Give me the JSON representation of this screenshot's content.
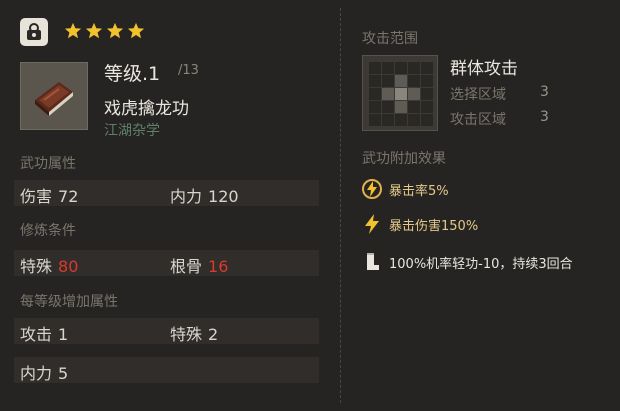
{
  "header": {
    "stars_count": 4
  },
  "item": {
    "level_label": "等级.1",
    "level_max": "/13",
    "name": "戏虎擒龙功",
    "category": "江湖杂学"
  },
  "sections": {
    "attributes": "武功属性",
    "requirements": "修炼条件",
    "per_level": "每等级增加属性"
  },
  "attributes": [
    {
      "label": "伤害",
      "value": "72"
    },
    {
      "label": "内力",
      "value": "120"
    }
  ],
  "requirements": [
    {
      "label": "特殊",
      "value": "80"
    },
    {
      "label": "根骨",
      "value": "16"
    }
  ],
  "per_level": [
    {
      "label": "攻击",
      "value": "1"
    },
    {
      "label": "特殊",
      "value": "2"
    },
    {
      "label": "内力",
      "value": "5"
    }
  ],
  "attack_range": {
    "label": "攻击范围",
    "name": "群体攻击",
    "select_label": "选择区域",
    "select_value": "3",
    "attack_label": "攻击区域",
    "attack_value": "3"
  },
  "effects": {
    "label": "武功附加效果",
    "items": [
      {
        "text": "暴击率5%",
        "icon": "lightning-circle-icon"
      },
      {
        "text": "暴击伤害150%",
        "icon": "lightning-icon"
      },
      {
        "text": "100%机率轻功-10，持续3回合",
        "icon": "boot-icon"
      }
    ]
  },
  "colors": {
    "star": "#f2c12e",
    "effect_text": "#e3c98a",
    "warning_value": "#d83a2e"
  }
}
